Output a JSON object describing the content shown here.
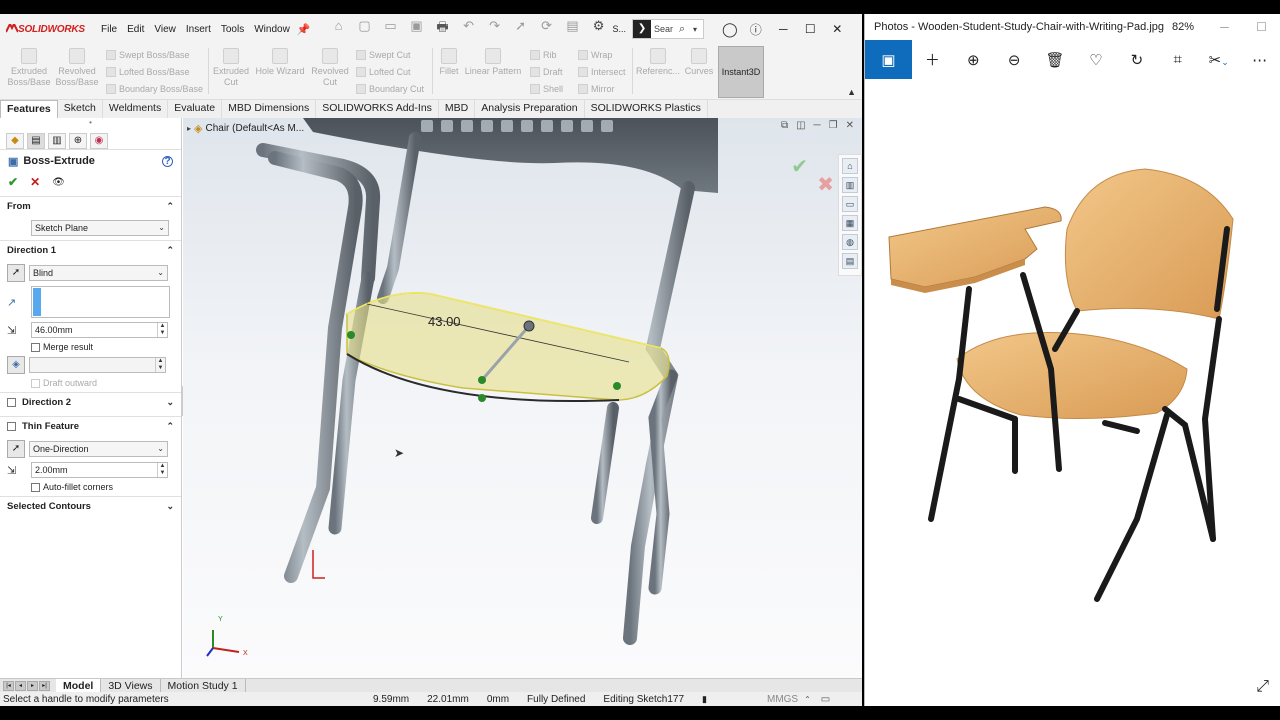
{
  "solidworks": {
    "logo": "SOLIDWORKS",
    "menu": [
      "File",
      "Edit",
      "View",
      "Insert",
      "Tools",
      "Window"
    ],
    "search_placeholder": "Sear",
    "search_prefix": "S...",
    "ribbon": {
      "extruded_boss": "Extruded\nBoss/Base",
      "revolved_boss": "Revolved\nBoss/Base",
      "swept_boss": "Swept Boss/Base",
      "lofted_boss": "Lofted Boss/Base",
      "boundary_boss": "Boundary Boss/Base",
      "extruded_cut": "Extruded\nCut",
      "hole_wizard": "Hole Wizard",
      "revolved_cut": "Revolved\nCut",
      "swept_cut": "Swept Cut",
      "lofted_cut": "Lofted Cut",
      "boundary_cut": "Boundary Cut",
      "fillet": "Fillet",
      "linear_pattern": "Linear Pattern",
      "rib": "Rib",
      "draft": "Draft",
      "shell": "Shell",
      "wrap": "Wrap",
      "intersect": "Intersect",
      "mirror": "Mirror",
      "reference": "Referenc...",
      "curves": "Curves",
      "instant3d": "Instant3D"
    },
    "command_tabs": [
      "Features",
      "Sketch",
      "Weldments",
      "Evaluate",
      "MBD Dimensions",
      "SOLIDWORKS Add-Ins",
      "MBD",
      "Analysis Preparation",
      "SOLIDWORKS Plastics"
    ],
    "property_manager": {
      "title": "Boss-Extrude",
      "from_label": "From",
      "from_value": "Sketch Plane",
      "direction1_label": "Direction 1",
      "end_condition": "Blind",
      "depth": "46.00mm",
      "merge_result": "Merge result",
      "draft_outward": "Draft outward",
      "direction2_label": "Direction 2",
      "thin_feature_label": "Thin Feature",
      "thin_type": "One-Direction",
      "thickness": "2.00mm",
      "auto_fillet": "Auto-fillet corners",
      "selected_contours": "Selected Contours"
    },
    "tree_label": "Chair (Default<As M...",
    "dimension": "43.00",
    "bottom_tabs": [
      "Model",
      "3D Views",
      "Motion Study 1"
    ],
    "status": {
      "message": "Select a handle to modify parameters",
      "x": "9.59mm",
      "y": "22.01mm",
      "z": "0mm",
      "state": "Fully Defined",
      "editing": "Editing Sketch177",
      "units": "MMGS"
    }
  },
  "photos": {
    "title": "Photos - Wooden-Student-Study-Chair-with-Writing-Pad.jpg",
    "zoom": "82%"
  },
  "colors": {
    "photos_accent": "#0f6cbd",
    "sw_logo": "#d02020",
    "extrude_preview": "#e6e08a"
  }
}
